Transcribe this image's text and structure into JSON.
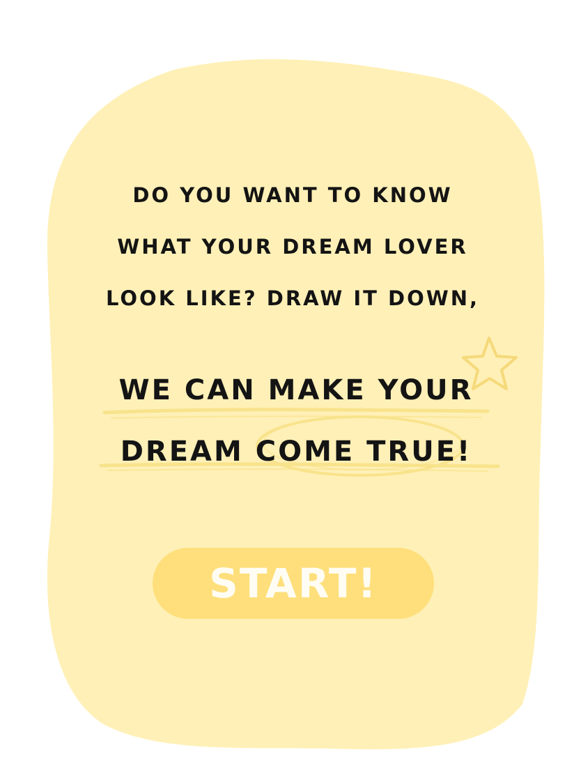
{
  "colors": {
    "card_background": "#fff0b7",
    "button_background": "#fedf7b",
    "button_text": "#fffdf3",
    "accent_underline": "#f8e38c",
    "text": "#141414"
  },
  "intro": {
    "lines": [
      "DO YOU WANT TO KNOW",
      "WHAT YOUR DREAM LOVER",
      "LOOK LIKE? DRAW IT DOWN,"
    ]
  },
  "headline": {
    "lines": [
      "WE CAN MAKE YOUR",
      "DREAM COME TRUE!"
    ]
  },
  "start_button": {
    "label": "START!"
  },
  "decorations": {
    "star_icon": "star-icon",
    "highlight_circle": "circle-highlight"
  }
}
